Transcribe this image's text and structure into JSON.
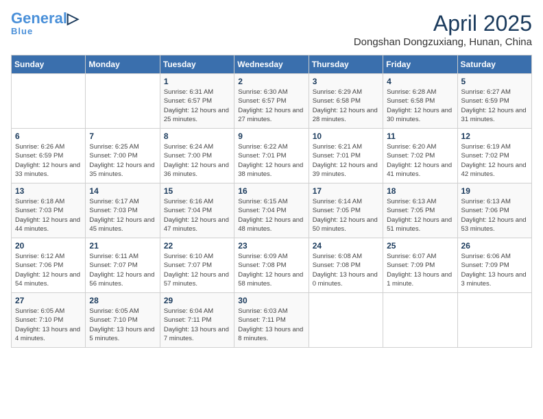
{
  "header": {
    "logo_general": "General",
    "logo_blue": "Blue",
    "month_year": "April 2025",
    "location": "Dongshan Dongzuxiang, Hunan, China"
  },
  "weekdays": [
    "Sunday",
    "Monday",
    "Tuesday",
    "Wednesday",
    "Thursday",
    "Friday",
    "Saturday"
  ],
  "weeks": [
    [
      {
        "day": "",
        "info": ""
      },
      {
        "day": "",
        "info": ""
      },
      {
        "day": "1",
        "info": "Sunrise: 6:31 AM\nSunset: 6:57 PM\nDaylight: 12 hours and 25 minutes."
      },
      {
        "day": "2",
        "info": "Sunrise: 6:30 AM\nSunset: 6:57 PM\nDaylight: 12 hours and 27 minutes."
      },
      {
        "day": "3",
        "info": "Sunrise: 6:29 AM\nSunset: 6:58 PM\nDaylight: 12 hours and 28 minutes."
      },
      {
        "day": "4",
        "info": "Sunrise: 6:28 AM\nSunset: 6:58 PM\nDaylight: 12 hours and 30 minutes."
      },
      {
        "day": "5",
        "info": "Sunrise: 6:27 AM\nSunset: 6:59 PM\nDaylight: 12 hours and 31 minutes."
      }
    ],
    [
      {
        "day": "6",
        "info": "Sunrise: 6:26 AM\nSunset: 6:59 PM\nDaylight: 12 hours and 33 minutes."
      },
      {
        "day": "7",
        "info": "Sunrise: 6:25 AM\nSunset: 7:00 PM\nDaylight: 12 hours and 35 minutes."
      },
      {
        "day": "8",
        "info": "Sunrise: 6:24 AM\nSunset: 7:00 PM\nDaylight: 12 hours and 36 minutes."
      },
      {
        "day": "9",
        "info": "Sunrise: 6:22 AM\nSunset: 7:01 PM\nDaylight: 12 hours and 38 minutes."
      },
      {
        "day": "10",
        "info": "Sunrise: 6:21 AM\nSunset: 7:01 PM\nDaylight: 12 hours and 39 minutes."
      },
      {
        "day": "11",
        "info": "Sunrise: 6:20 AM\nSunset: 7:02 PM\nDaylight: 12 hours and 41 minutes."
      },
      {
        "day": "12",
        "info": "Sunrise: 6:19 AM\nSunset: 7:02 PM\nDaylight: 12 hours and 42 minutes."
      }
    ],
    [
      {
        "day": "13",
        "info": "Sunrise: 6:18 AM\nSunset: 7:03 PM\nDaylight: 12 hours and 44 minutes."
      },
      {
        "day": "14",
        "info": "Sunrise: 6:17 AM\nSunset: 7:03 PM\nDaylight: 12 hours and 45 minutes."
      },
      {
        "day": "15",
        "info": "Sunrise: 6:16 AM\nSunset: 7:04 PM\nDaylight: 12 hours and 47 minutes."
      },
      {
        "day": "16",
        "info": "Sunrise: 6:15 AM\nSunset: 7:04 PM\nDaylight: 12 hours and 48 minutes."
      },
      {
        "day": "17",
        "info": "Sunrise: 6:14 AM\nSunset: 7:05 PM\nDaylight: 12 hours and 50 minutes."
      },
      {
        "day": "18",
        "info": "Sunrise: 6:13 AM\nSunset: 7:05 PM\nDaylight: 12 hours and 51 minutes."
      },
      {
        "day": "19",
        "info": "Sunrise: 6:13 AM\nSunset: 7:06 PM\nDaylight: 12 hours and 53 minutes."
      }
    ],
    [
      {
        "day": "20",
        "info": "Sunrise: 6:12 AM\nSunset: 7:06 PM\nDaylight: 12 hours and 54 minutes."
      },
      {
        "day": "21",
        "info": "Sunrise: 6:11 AM\nSunset: 7:07 PM\nDaylight: 12 hours and 56 minutes."
      },
      {
        "day": "22",
        "info": "Sunrise: 6:10 AM\nSunset: 7:07 PM\nDaylight: 12 hours and 57 minutes."
      },
      {
        "day": "23",
        "info": "Sunrise: 6:09 AM\nSunset: 7:08 PM\nDaylight: 12 hours and 58 minutes."
      },
      {
        "day": "24",
        "info": "Sunrise: 6:08 AM\nSunset: 7:08 PM\nDaylight: 13 hours and 0 minutes."
      },
      {
        "day": "25",
        "info": "Sunrise: 6:07 AM\nSunset: 7:09 PM\nDaylight: 13 hours and 1 minute."
      },
      {
        "day": "26",
        "info": "Sunrise: 6:06 AM\nSunset: 7:09 PM\nDaylight: 13 hours and 3 minutes."
      }
    ],
    [
      {
        "day": "27",
        "info": "Sunrise: 6:05 AM\nSunset: 7:10 PM\nDaylight: 13 hours and 4 minutes."
      },
      {
        "day": "28",
        "info": "Sunrise: 6:05 AM\nSunset: 7:10 PM\nDaylight: 13 hours and 5 minutes."
      },
      {
        "day": "29",
        "info": "Sunrise: 6:04 AM\nSunset: 7:11 PM\nDaylight: 13 hours and 7 minutes."
      },
      {
        "day": "30",
        "info": "Sunrise: 6:03 AM\nSunset: 7:11 PM\nDaylight: 13 hours and 8 minutes."
      },
      {
        "day": "",
        "info": ""
      },
      {
        "day": "",
        "info": ""
      },
      {
        "day": "",
        "info": ""
      }
    ]
  ]
}
